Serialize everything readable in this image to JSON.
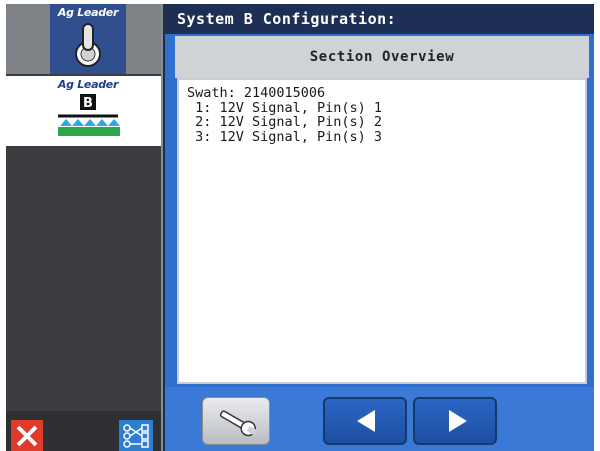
{
  "sidebar": {
    "modules": [
      {
        "brand": "Ag Leader",
        "icon": "toggle-switch-icon"
      },
      {
        "brand": "Ag Leader",
        "icon": "boom-b-icon",
        "badge": "B"
      }
    ],
    "close_icon": "close-x-icon",
    "config_icon": "configuration-grid-icon"
  },
  "header": {
    "title": "System B Configuration:"
  },
  "section": {
    "heading": "Section Overview"
  },
  "content": {
    "lines": [
      "Swath: 2140015006",
      " 1: 12V Signal, Pin(s) 1",
      " 2: 12V Signal, Pin(s) 2",
      " 3: 12V Signal, Pin(s) 3"
    ]
  },
  "footer": {
    "wrench_icon": "wrench-icon",
    "prev_icon": "arrow-left-icon",
    "next_icon": "arrow-right-icon"
  },
  "colors": {
    "title_bar": "#1e2f55",
    "panel_blue": "#2f6fd0",
    "close_red": "#e03a2a",
    "config_blue": "#2e7fd1"
  }
}
